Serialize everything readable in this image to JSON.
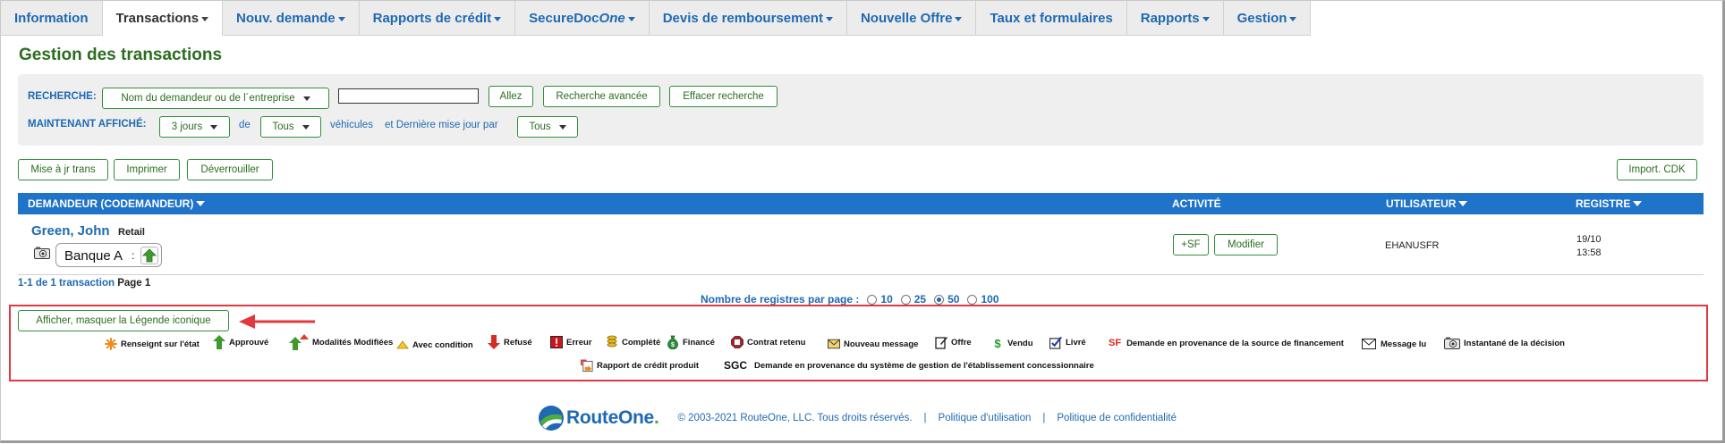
{
  "nav": {
    "tabs": [
      {
        "label": "Information",
        "caret": false,
        "active": false
      },
      {
        "label": "Transactions",
        "caret": true,
        "active": true
      },
      {
        "label": "Nouv. demande",
        "caret": true,
        "active": false
      },
      {
        "label": "Rapports de crédit",
        "caret": true,
        "active": false
      },
      {
        "label": "SecureDoc",
        "italic": "One",
        "caret": true,
        "active": false
      },
      {
        "label": "Devis de remboursement",
        "caret": true,
        "active": false
      },
      {
        "label": "Nouvelle Offre",
        "caret": true,
        "active": false
      },
      {
        "label": "Taux et formulaires",
        "caret": false,
        "active": false
      },
      {
        "label": "Rapports",
        "caret": true,
        "active": false
      },
      {
        "label": "Gestion",
        "caret": true,
        "active": false
      }
    ]
  },
  "page_title": "Gestion des transactions",
  "search": {
    "label": "RECHERCHE:",
    "field_select": "Nom du demandeur ou de l´entreprise",
    "input_value": "",
    "go_button": "Allez",
    "advanced_button": "Recherche avancée",
    "clear_button": "Effacer recherche",
    "showing_label": "MAINTENANT AFFICHÉ:",
    "days_select": "3 jours",
    "de_label": "de",
    "vehicles_select": "Tous",
    "vehicles_label": "véhicules",
    "updated_by_label": "et Dernière mise jour par",
    "updated_by_select": "Tous"
  },
  "actions": {
    "update": "Mise à jr trans",
    "print": "Imprimer",
    "unlock": "Déverrouiller",
    "import_cdk": "Import. CDK"
  },
  "table": {
    "headers": {
      "applicant": "DEMANDEUR (CODEMANDEUR)",
      "activity": "ACTIVITÉ",
      "user": "UTILISATEUR",
      "register": "REGISTRE"
    },
    "rows": [
      {
        "name": "Green, John",
        "type": "Retail",
        "bank": "Banque A",
        "bank_colon": ":",
        "bank_status_icon": "approved-arrow-icon",
        "add_sf_button": "+SF",
        "modify_button": "Modifier",
        "user": "EHANUSFR",
        "date": "19/10",
        "time": "13:58"
      }
    ]
  },
  "pager": {
    "summary": "1-1 de 1 transaction",
    "page_label": "Page",
    "page_number": "1",
    "per_page_label": "Nombre de registres par page :",
    "options": [
      "10",
      "25",
      "50",
      "100"
    ],
    "selected": "50"
  },
  "legend": {
    "toggle_button": "Afficher, masquer la Légende iconique",
    "items": [
      {
        "label": "Renseignt sur l'état",
        "icon": "status-info-icon"
      },
      {
        "label": "Approuvé",
        "icon": "approved-icon"
      },
      {
        "label": "Modalités Modifiées",
        "icon": "terms-modified-icon"
      },
      {
        "label": "Avec condition",
        "icon": "conditional-icon"
      },
      {
        "label": "Refusé",
        "icon": "declined-icon"
      },
      {
        "label": "Erreur",
        "icon": "error-icon"
      },
      {
        "label": "Complété",
        "icon": "completed-icon"
      },
      {
        "label": "Financé",
        "icon": "funded-icon"
      },
      {
        "label": "Contrat retenu",
        "icon": "contract-held-icon"
      },
      {
        "label": "Nouveau message",
        "icon": "new-message-icon"
      },
      {
        "label": "Offre",
        "icon": "offer-icon"
      },
      {
        "label": "Vendu",
        "icon": "sold-icon",
        "glyph": "$"
      },
      {
        "label": "Livré",
        "icon": "delivered-icon"
      },
      {
        "label": "Demande en provenance de la source de financement",
        "icon": "sf-icon",
        "glyph": "SF"
      },
      {
        "label": "Message lu",
        "icon": "message-read-icon"
      },
      {
        "label": "Instantané de la décision",
        "icon": "decision-snapshot-icon"
      },
      {
        "label": "Rapport de crédit produit",
        "icon": "credit-report-icon"
      },
      {
        "label": "Demande en provenance du système de gestion de l'établissement concessionnaire",
        "icon": "sgc-icon",
        "glyph": "SGC"
      }
    ]
  },
  "footer": {
    "logo_text": "RouteOne",
    "logo_mark": ".",
    "copyright": "© 2003-2021  RouteOne, LLC. Tous droits réservés.",
    "separator": "|",
    "terms_link": "Politique d'utilisation",
    "privacy_link": "Politique de confidentialité"
  },
  "colors": {
    "brand_blue": "#1f69b2",
    "header_blue": "#1f73c8",
    "title_green": "#2b6e1f",
    "button_border": "#2f8f3a",
    "highlight_red": "#e2383f",
    "panel_gray": "#efefef"
  }
}
